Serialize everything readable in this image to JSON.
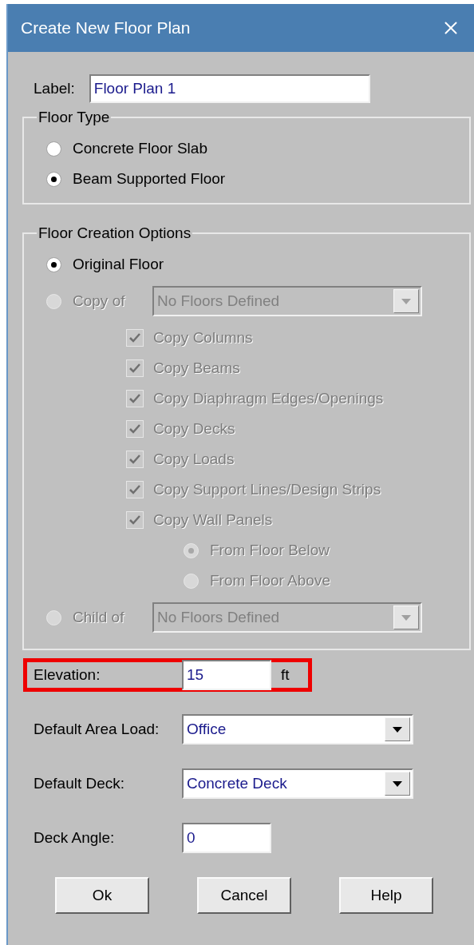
{
  "window": {
    "title": "Create New Floor Plan"
  },
  "label_field": {
    "label": "Label:",
    "value": "Floor Plan 1"
  },
  "floor_type": {
    "title": "Floor Type",
    "options": [
      {
        "label": "Concrete Floor Slab",
        "selected": false
      },
      {
        "label": "Beam Supported Floor",
        "selected": true
      }
    ]
  },
  "floor_creation_options": {
    "title": "Floor Creation Options",
    "options": [
      {
        "kind": "radio",
        "label": "Original Floor",
        "selected": true,
        "disabled": false
      },
      {
        "kind": "radio-select",
        "label": "Copy of",
        "selected": false,
        "disabled": true,
        "value": "No Floors Defined",
        "children": [
          {
            "kind": "checkbox",
            "label": "Copy Columns",
            "checked": true,
            "disabled": true
          },
          {
            "kind": "checkbox",
            "label": "Copy Beams",
            "checked": true,
            "disabled": true
          },
          {
            "kind": "checkbox",
            "label": "Copy Diaphragm Edges/Openings",
            "checked": true,
            "disabled": true
          },
          {
            "kind": "checkbox",
            "label": "Copy Decks",
            "checked": true,
            "disabled": true
          },
          {
            "kind": "checkbox",
            "label": "Copy Loads",
            "checked": true,
            "disabled": true
          },
          {
            "kind": "checkbox",
            "label": "Copy Support Lines/Design Strips",
            "checked": true,
            "disabled": true
          },
          {
            "kind": "checkbox",
            "label": "Copy Wall Panels",
            "checked": true,
            "disabled": true,
            "children": [
              {
                "kind": "radio",
                "label": "From Floor Below",
                "selected": true,
                "disabled": true
              },
              {
                "kind": "radio",
                "label": "From Floor Above",
                "selected": false,
                "disabled": true
              }
            ]
          }
        ]
      },
      {
        "kind": "radio-select",
        "label": "Child of",
        "selected": false,
        "disabled": true,
        "value": "No Floors Defined"
      }
    ]
  },
  "fields": [
    {
      "kind": "text",
      "label": "Elevation:",
      "value": "15",
      "unit": "ft",
      "highlighted": true
    },
    {
      "kind": "select",
      "label": "Default Area Load:",
      "value": "Office",
      "highlighted": false
    },
    {
      "kind": "select",
      "label": "Default Deck:",
      "value": "Concrete Deck",
      "highlighted": false
    },
    {
      "kind": "text",
      "label": "Deck Angle:",
      "value": "0",
      "highlighted": false
    }
  ],
  "buttons": [
    "Ok",
    "Cancel",
    "Help"
  ]
}
